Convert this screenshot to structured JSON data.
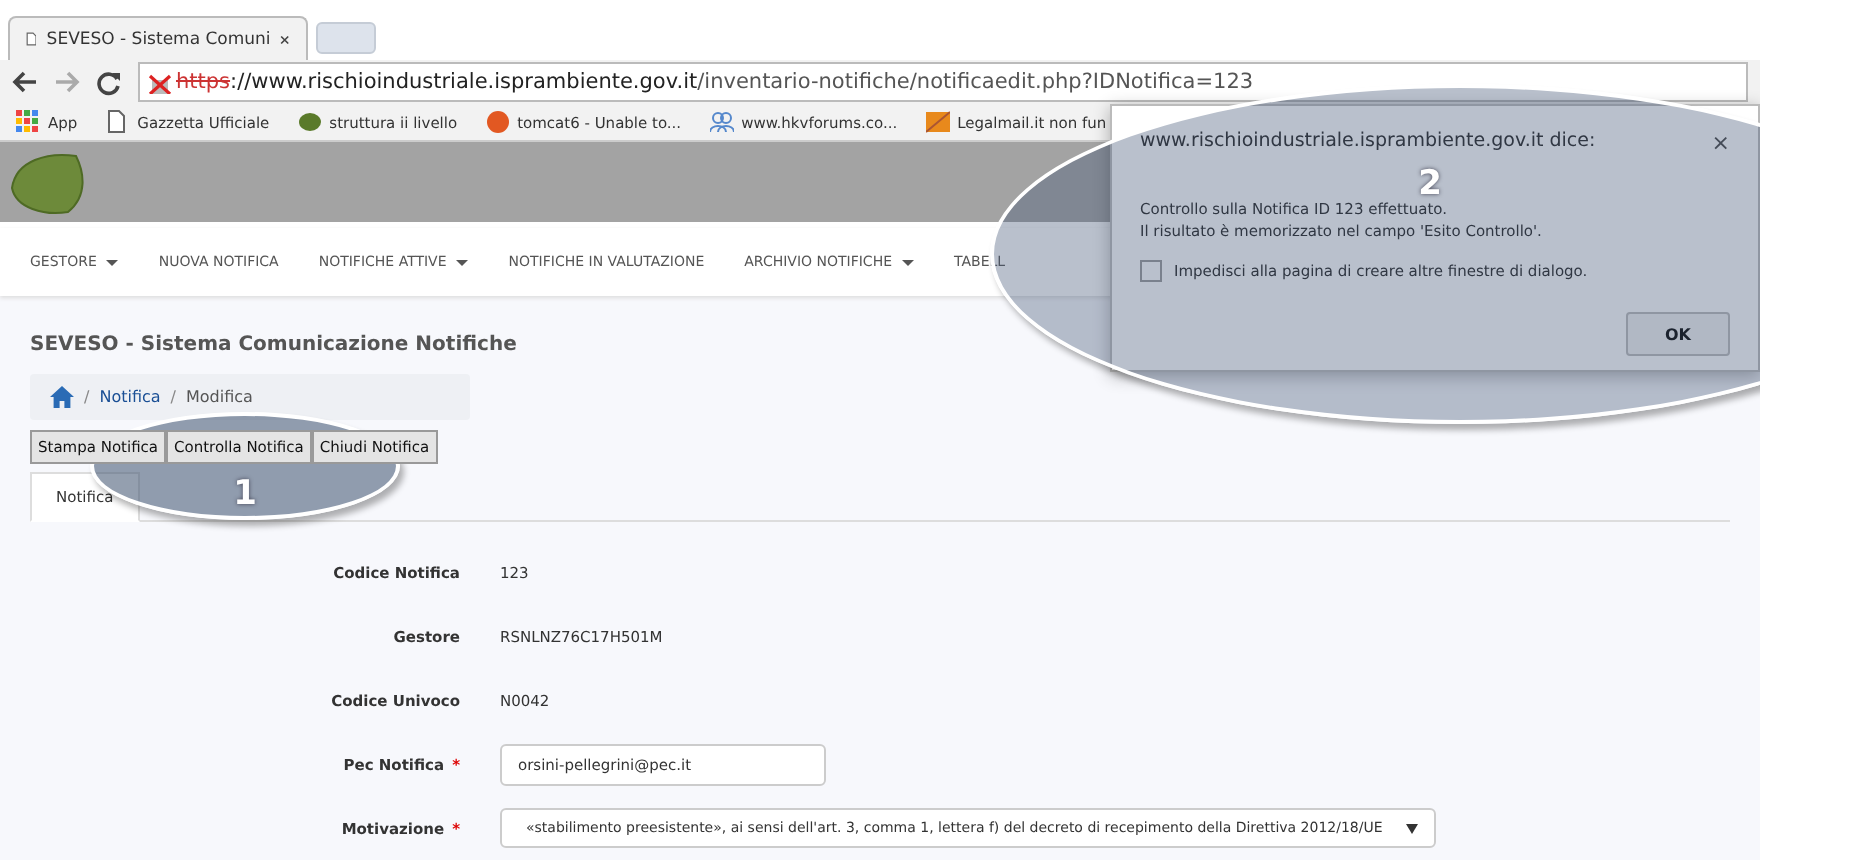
{
  "browser": {
    "tab_title": "SEVESO - Sistema Comuni",
    "url": {
      "protocol": "https",
      "host": "://www.rischioindustriale.isprambiente.gov.it",
      "path": "/inventario-notifiche/notificaedit.php?IDNotifica=123"
    },
    "bookmarks": [
      {
        "kind": "apps",
        "label": "App"
      },
      {
        "kind": "page",
        "label": "Gazzetta Ufficiale"
      },
      {
        "kind": "leaf",
        "label": "struttura ii livello"
      },
      {
        "kind": "ask",
        "label": "tomcat6 - Unable to..."
      },
      {
        "kind": "people",
        "label": "www.hkvforums.co..."
      },
      {
        "kind": "mail",
        "label": "Legalmail.it non fun"
      }
    ]
  },
  "nav": [
    {
      "label": "GESTORE",
      "dropdown": true
    },
    {
      "label": "NUOVA NOTIFICA",
      "dropdown": false
    },
    {
      "label": "NOTIFICHE ATTIVE",
      "dropdown": true
    },
    {
      "label": "NOTIFICHE IN VALUTAZIONE",
      "dropdown": false
    },
    {
      "label": "ARCHIVIO NOTIFICHE",
      "dropdown": true
    },
    {
      "label": "TABELL",
      "dropdown": false
    }
  ],
  "page_title": "SEVESO - Sistema Comunicazione Notifiche",
  "breadcrumb": [
    {
      "separator": "/",
      "label": "Notifica"
    },
    {
      "separator": "/",
      "label": "Modifica"
    }
  ],
  "actions": [
    "Stampa Notifica",
    "Controlla Notifica",
    "Chiudi Notifica"
  ],
  "tabs": [
    {
      "label": "Notifica",
      "selected": true
    }
  ],
  "form": [
    {
      "kind": "text",
      "label": "Codice Notifica",
      "required": false,
      "value": "123"
    },
    {
      "kind": "text",
      "label": "Gestore",
      "required": false,
      "value": "RSNLNZ76C17H501M"
    },
    {
      "kind": "text",
      "label": "Codice Univoco",
      "required": false,
      "value": "N0042"
    },
    {
      "kind": "input",
      "label": "Pec Notifica",
      "required": true,
      "required_mark": "*",
      "value": "orsini-pellegrini@pec.it"
    },
    {
      "kind": "select",
      "label": "Motivazione",
      "required": true,
      "required_mark": "*",
      "value": "«stabilimento preesistente», ai sensi dell'art. 3, comma 1, lettera f) del decreto di recepimento della Direttiva 2012/18/UE"
    }
  ],
  "dialog": {
    "title": "www.rischioindustriale.isprambiente.gov.it dice:",
    "close": "×",
    "message": [
      "Controllo sulla Notifica ID 123 effettuato.",
      "Il risultato è memorizzato nel campo 'Esito Controllo'."
    ],
    "checkbox": {
      "label": "Impedisci alla pagina di creare altre finestre di dialogo.",
      "checked": false
    },
    "button": "OK"
  },
  "annotations": [
    {
      "label": "1"
    },
    {
      "label": "2"
    }
  ]
}
